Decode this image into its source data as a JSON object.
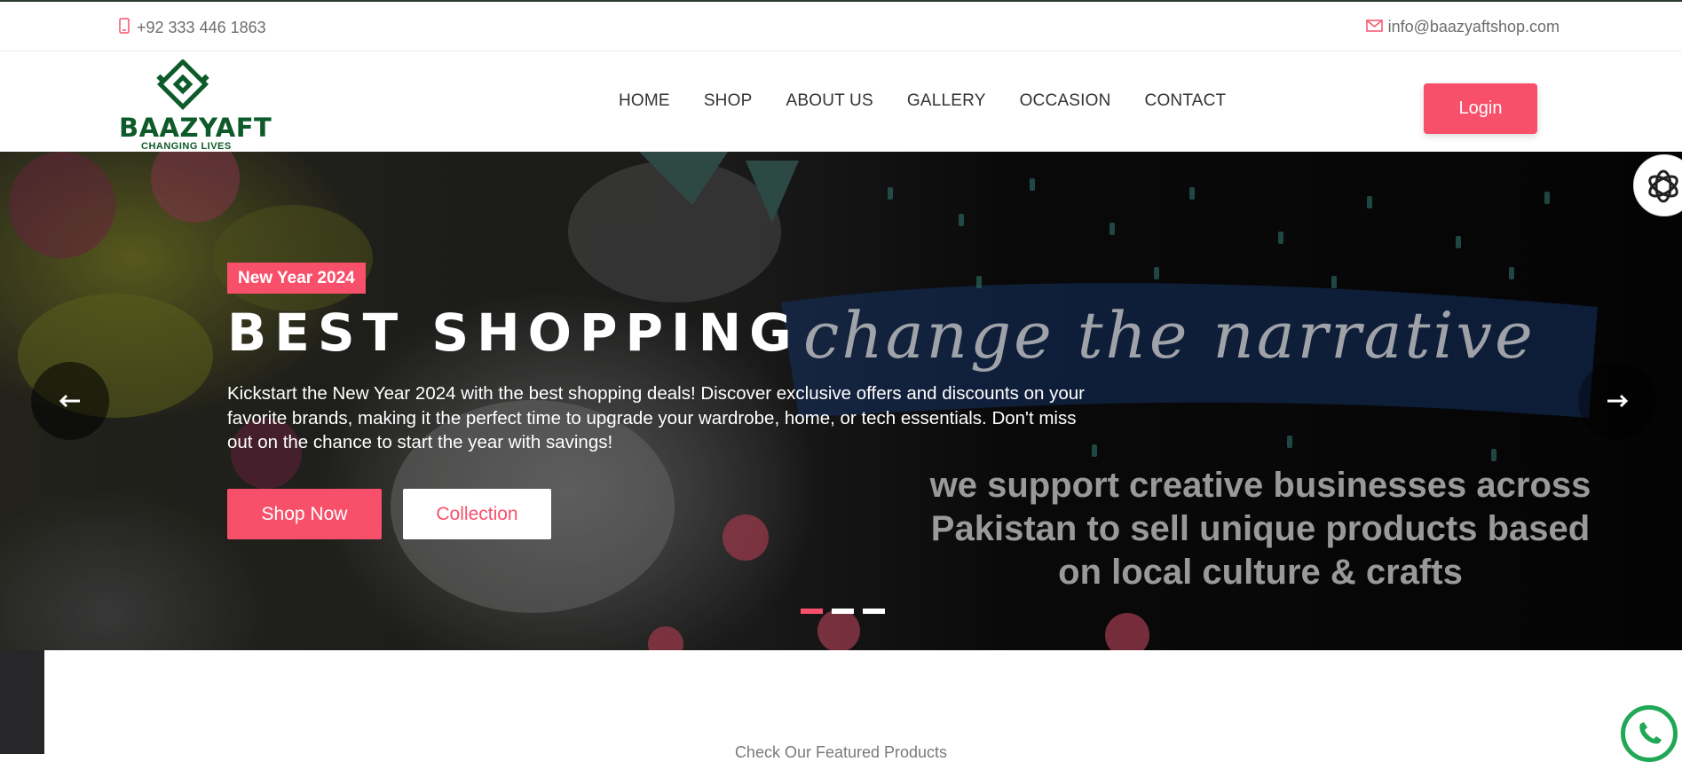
{
  "topbar": {
    "phone": "+92 333 446 1863",
    "email": "info@baazyaftshop.com",
    "phone_icon": "mobile-phone-icon",
    "email_icon": "envelope-icon"
  },
  "brand": {
    "name": "BAAZYAFT",
    "tagline": "CHANGING LIVES",
    "color": "#0d5a2a"
  },
  "nav": {
    "items": [
      "HOME",
      "SHOP",
      "ABOUT US",
      "GALLERY",
      "OCCASION",
      "CONTACT"
    ]
  },
  "header": {
    "login_label": "Login"
  },
  "hero": {
    "badge": "New Year 2024",
    "title": "BEST SHOPPING",
    "description": "Kickstart the New Year 2024 with the best shopping deals! Discover exclusive offers and discounts on your favorite brands, making it the perfect time to upgrade your wardrobe, home, or tech essentials. Don't miss out on the chance to start the year with savings!",
    "shop_now": "Shop Now",
    "collection": "Collection",
    "script_text": "change the narrative",
    "support_text": "we support creative businesses across Pakistan to sell unique products based on local culture & crafts",
    "slides": 3,
    "active_slide": 1
  },
  "section": {
    "featured_label": "Check Our Featured Products"
  },
  "colors": {
    "accent": "#f8506b",
    "text": "#333333",
    "muted": "#6d6d6d"
  }
}
